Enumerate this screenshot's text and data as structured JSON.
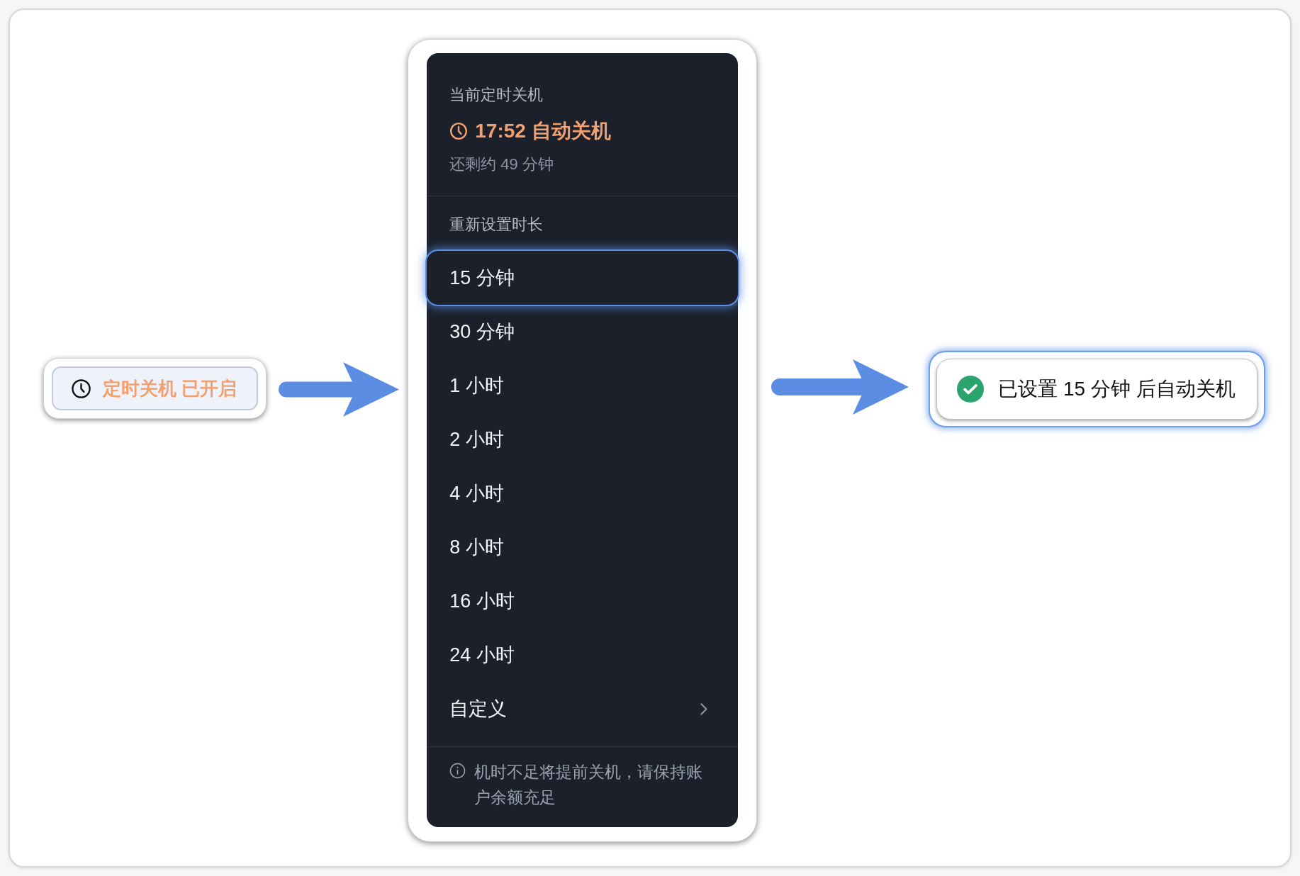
{
  "trigger_button": {
    "label": "定时关机 已开启"
  },
  "menu": {
    "current_label": "当前定时关机",
    "scheduled_time": "17:52 自动关机",
    "remaining": "还剩约 49 分钟",
    "section_label": "重新设置时长",
    "options": [
      {
        "label": "15 分钟",
        "selected": true,
        "kind": "option"
      },
      {
        "label": "30 分钟",
        "selected": false,
        "kind": "option"
      },
      {
        "label": "1 小时",
        "selected": false,
        "kind": "option"
      },
      {
        "label": "2 小时",
        "selected": false,
        "kind": "option"
      },
      {
        "label": "4 小时",
        "selected": false,
        "kind": "option"
      },
      {
        "label": "8 小时",
        "selected": false,
        "kind": "option"
      },
      {
        "label": "16 小时",
        "selected": false,
        "kind": "option"
      },
      {
        "label": "24 小时",
        "selected": false,
        "kind": "option"
      },
      {
        "label": "自定义",
        "selected": false,
        "kind": "submenu"
      }
    ],
    "note": "机时不足将提前关机，请保持账户余额充足"
  },
  "toast": {
    "message": "已设置 15 分钟 后自动关机"
  }
}
